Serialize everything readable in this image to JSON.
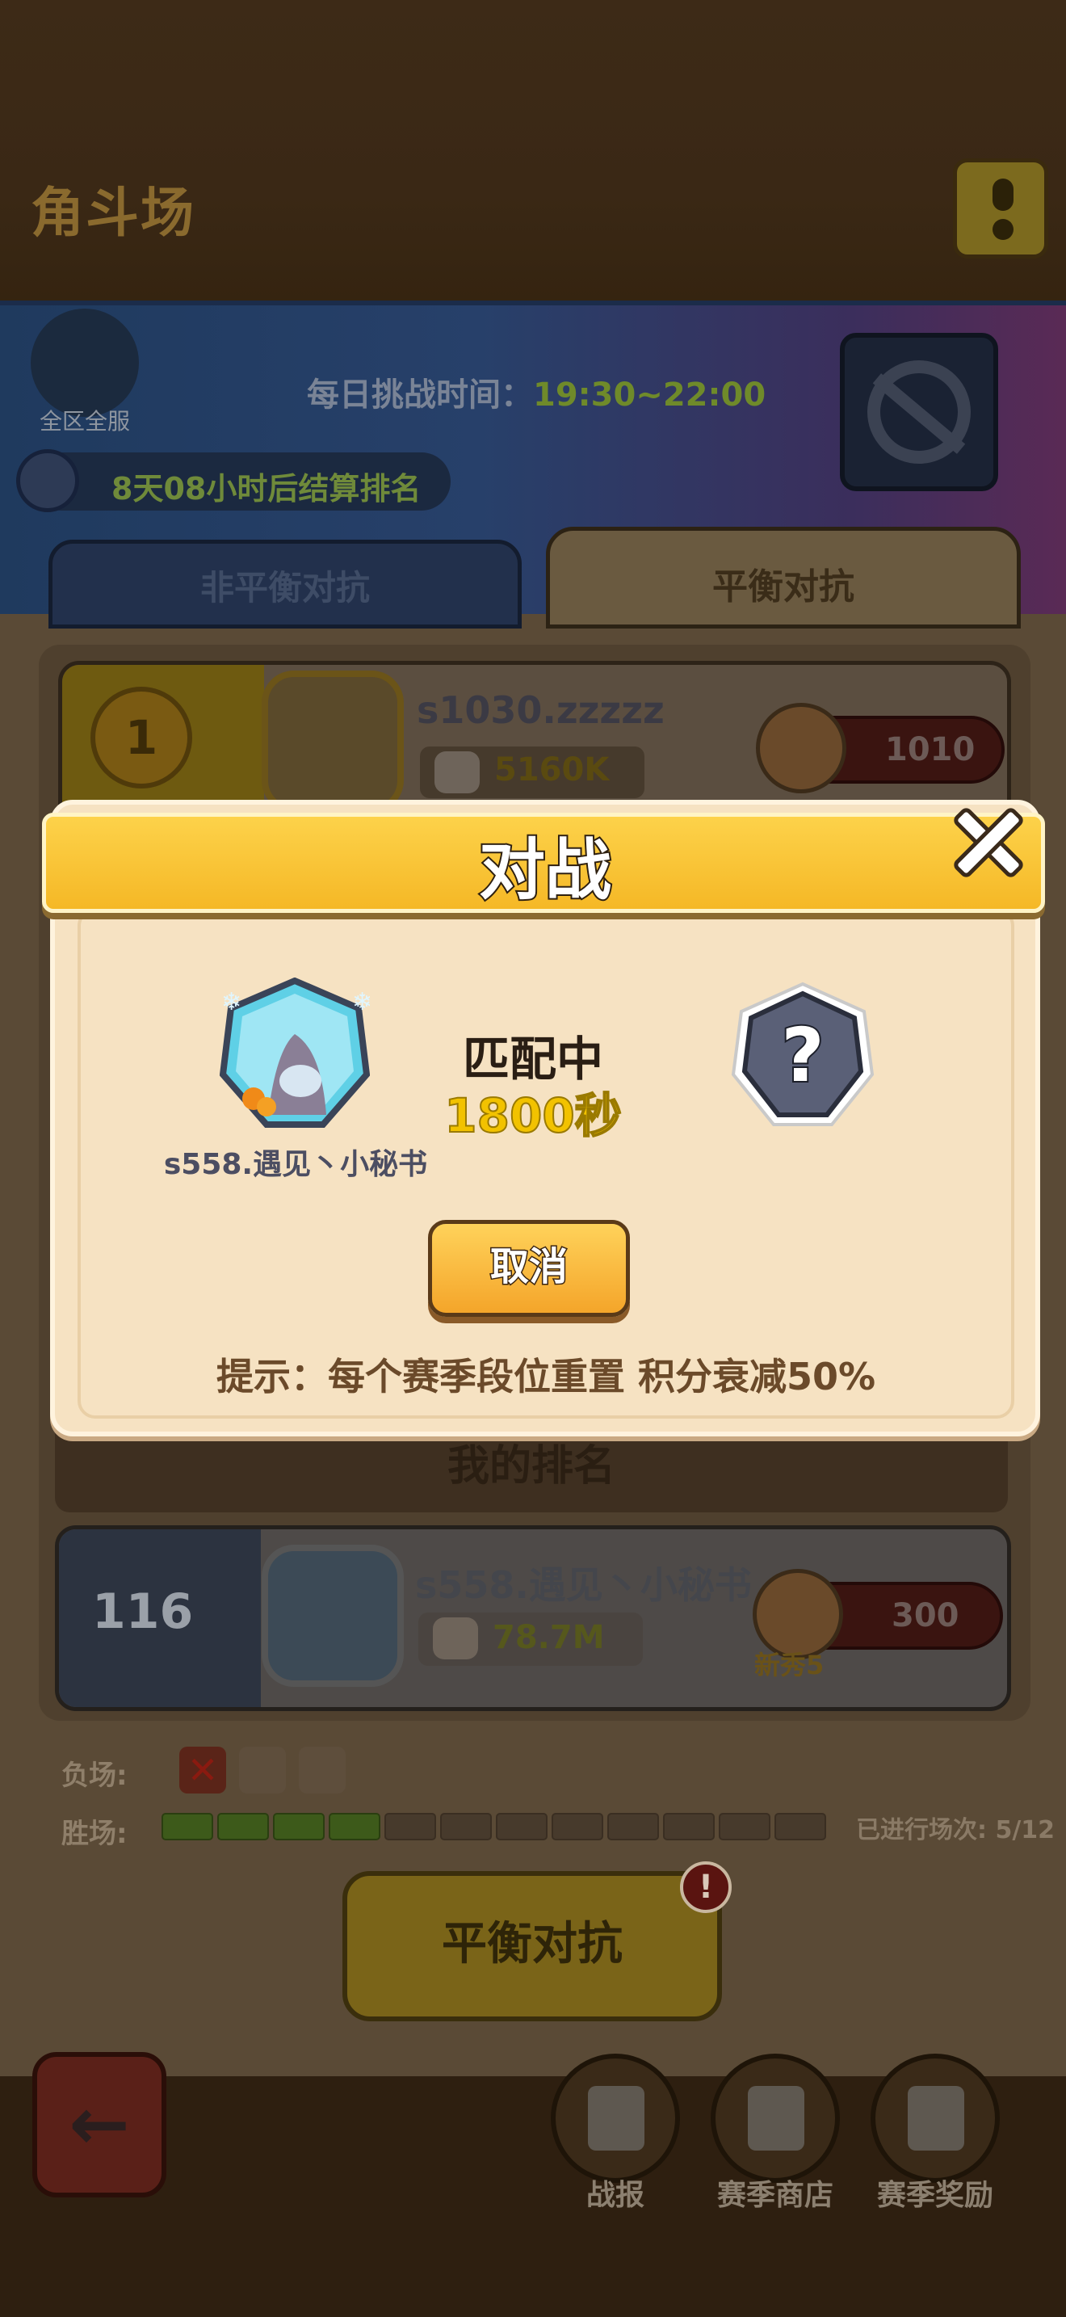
{
  "header": {
    "title": "角斗场"
  },
  "banner": {
    "server_label": "全区全服",
    "daily_label": "每日挑战时间：",
    "daily_time": "19:30~22:00",
    "countdown": "8天08小时后结算排名"
  },
  "tabs": [
    {
      "label": "非平衡对抗"
    },
    {
      "label": "平衡对抗"
    }
  ],
  "leaderboard": {
    "rows": [
      {
        "rank": "1",
        "name": "s1030.zzzzz",
        "power": "5160K",
        "score": "1010"
      }
    ],
    "my_rank_label": "我的排名",
    "me": {
      "rank": "116",
      "name": "s558.遇见丶小秘书",
      "power": "78.7M",
      "score": "300",
      "title": "新秀5"
    }
  },
  "record": {
    "loss_label": "负场:",
    "losses": 1,
    "loss_slots": 3,
    "win_label": "胜场:",
    "wins": 4,
    "win_slots": 12,
    "played": "已进行场次: 5/12"
  },
  "main_button": {
    "label": "平衡对抗",
    "alert": "!"
  },
  "bottom_nav": [
    {
      "label": "战报",
      "icon": "report-icon"
    },
    {
      "label": "赛季商店",
      "icon": "shop-icon"
    },
    {
      "label": "赛季奖励",
      "icon": "gift-icon"
    }
  ],
  "modal": {
    "title": "对战",
    "player_name": "s558.遇见丶小秘书",
    "status": "匹配中",
    "seconds": "1800秒",
    "opponent_placeholder": "?",
    "cancel_label": "取消",
    "tip": "提示：每个赛季段位重置 积分衰减50%"
  },
  "colors": {
    "ribbon": "#f5b826",
    "accent_yellow": "#f2c200",
    "modal_bg": "#f6e2c2"
  }
}
